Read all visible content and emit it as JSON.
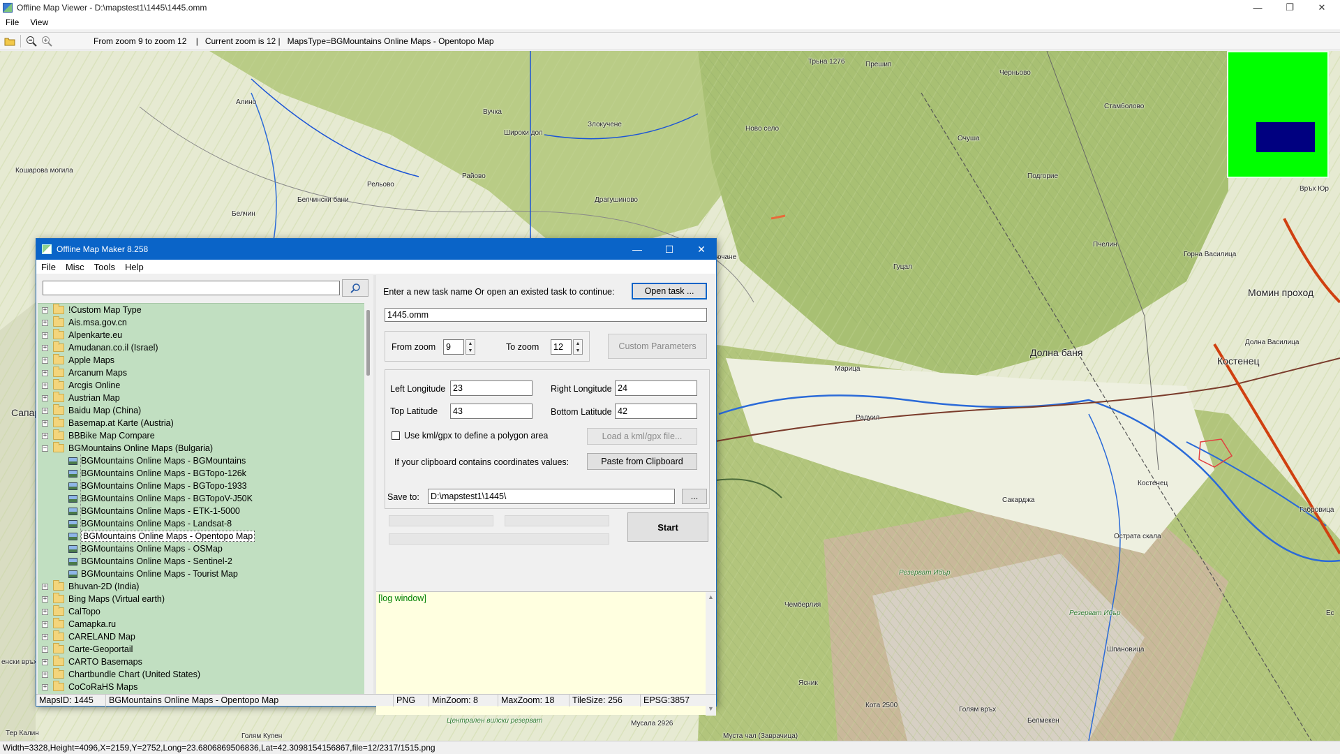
{
  "main_window": {
    "title": "Offline Map Viewer - D:\\mapstest1\\1445\\1445.omm",
    "menu": [
      "File",
      "View"
    ],
    "toolbar_status": "From zoom 9 to zoom 12    |   Current zoom is 12 |   MapsType=BGMountains Online Maps - Opentopo Map",
    "toolbar_icons": [
      "folder-open-icon",
      "zoom-out-icon",
      "zoom-in-icon"
    ],
    "status_bar": "Width=3328,Height=4096,X=2159,Y=2752,Long=23.6806869506836,Lat=42.3098154156867,file=12/2317/1515.png"
  },
  "map_labels": [
    {
      "text": "Трьна 1276",
      "name": "place-trana"
    },
    {
      "text": "Прешип",
      "name": "place-preshtip"
    },
    {
      "text": "Черньово",
      "name": "place-chernyovo"
    },
    {
      "text": "Стамболово",
      "name": "place-stambolovo"
    },
    {
      "text": "Алино",
      "name": "place-alino"
    },
    {
      "text": "Вучка",
      "name": "place-vuchka"
    },
    {
      "text": "Злокучене",
      "name": "place-zlokuchene"
    },
    {
      "text": "Широки дол",
      "name": "place-shiroki-dol"
    },
    {
      "text": "Ново село",
      "name": "place-novo-selo"
    },
    {
      "text": "Очуша",
      "name": "place-ochusha"
    },
    {
      "text": "Кошарова могила",
      "name": "place-kosharova-mogila"
    },
    {
      "text": "Рельово",
      "name": "place-relyovo"
    },
    {
      "text": "Райово",
      "name": "place-rayovo"
    },
    {
      "text": "Подгорие",
      "name": "place-podgorie"
    },
    {
      "text": "Белчински бани",
      "name": "place-belchinski-bani"
    },
    {
      "text": "Драгушиново",
      "name": "place-dragushinovo"
    },
    {
      "text": "Белчин",
      "name": "place-belchin"
    },
    {
      "text": "Връх Юр",
      "name": "place-vrah-yur"
    },
    {
      "text": "Пчелин",
      "name": "place-pchelin"
    },
    {
      "text": "Горна Василица",
      "name": "place-gorna-vasilitsa"
    },
    {
      "text": "Гуцал",
      "name": "place-gutsal"
    },
    {
      "text": "Момин проход",
      "name": "place-momin-prohod"
    },
    {
      "text": "Долна Василица",
      "name": "place-dolna-vasilitsa"
    },
    {
      "text": "Долна баня",
      "name": "place-dolna-banya"
    },
    {
      "text": "Костенец",
      "name": "place-kostenets"
    },
    {
      "text": "Марица",
      "name": "place-maritsa"
    },
    {
      "text": "Радуил",
      "name": "place-raduil"
    },
    {
      "text": "Костенец",
      "name": "place-kostenets-village"
    },
    {
      "text": "Сакарджа",
      "name": "place-sakardzha"
    },
    {
      "text": "Габровица",
      "name": "place-gabrovitsa"
    },
    {
      "text": "Острата скала",
      "name": "place-ostrata-skala"
    },
    {
      "text": "Резерват Ибър",
      "name": "place-rezervat-ibar"
    },
    {
      "text": "Резерват Ибър",
      "name": "place-rezervat-ibar-2"
    },
    {
      "text": "Чемберлия",
      "name": "place-chemberliya"
    },
    {
      "text": "Шпановица",
      "name": "place-shpanovitsa"
    },
    {
      "text": "Ясник",
      "name": "place-yasnik"
    },
    {
      "text": "Кота 2500",
      "name": "place-kota-2500"
    },
    {
      "text": "Голям връх",
      "name": "place-golyam-vrah"
    },
    {
      "text": "Белмекен",
      "name": "place-belmeken"
    },
    {
      "text": "Мусала 2926",
      "name": "place-musala"
    },
    {
      "text": "Централен вилски резерват",
      "name": "place-central-reserve"
    },
    {
      "text": "Голям Купен",
      "name": "place-golyam-kupen"
    },
    {
      "text": "Муста чал (Заврачица)",
      "name": "place-musta-chal"
    },
    {
      "text": "Сапар",
      "name": "place-sapar"
    },
    {
      "text": "ючане",
      "name": "place-yuchane"
    },
    {
      "text": "Ес",
      "name": "place-es"
    },
    {
      "text": "енски връх",
      "name": "place-enski-vrah"
    },
    {
      "text": "Тер Калин",
      "name": "place-ter-kalin"
    }
  ],
  "dialog": {
    "title": "Offline Map Maker 8.258",
    "menu": [
      "File",
      "Misc",
      "Tools",
      "Help"
    ],
    "search_value": "",
    "tree": {
      "top_items": [
        "!Custom Map Type",
        "Ais.msa.gov.cn",
        "Alpenkarte.eu",
        "Amudanan.co.il (Israel)",
        "Apple Maps",
        "Arcanum Maps",
        "Arcgis Online",
        "Austrian Map",
        "Baidu Map (China)",
        "Basemap.at Karte (Austria)",
        "BBBike Map Compare"
      ],
      "expanded_item": "BGMountains Online Maps (Bulgaria)",
      "children": [
        "BGMountains Online Maps - BGMountains",
        "BGMountains Online Maps - BGTopo-126k",
        "BGMountains Online Maps - BGTopo-1933",
        "BGMountains Online Maps - BGTopoV-J50K",
        "BGMountains Online Maps - ETK-1-5000",
        "BGMountains Online Maps - Landsat-8",
        "BGMountains Online Maps - Opentopo Map",
        "BGMountains Online Maps - OSMap",
        "BGMountains Online Maps - Sentinel-2",
        "BGMountains Online Maps - Tourist Map"
      ],
      "selected_child": "BGMountains Online Maps - Opentopo Map",
      "bottom_items": [
        "Bhuvan-2D (India)",
        "Bing Maps (Virtual earth)",
        "CalTopo",
        "Camapka.ru",
        "CARELAND Map",
        "Carte-Geoportail",
        "CARTO Basemaps",
        "Chartbundle Chart (United States)",
        "CoCoRaHS Maps"
      ]
    },
    "task_prompt": "Enter a new task name Or open an existed task to continue:",
    "open_task_label": "Open task ...",
    "task_name": "1445.omm",
    "from_zoom_label": "From zoom",
    "from_zoom_value": "9",
    "to_zoom_label": "To zoom",
    "to_zoom_value": "12",
    "custom_params_label": "Custom Parameters",
    "left_longitude_label": "Left Longitude",
    "left_longitude_value": "23",
    "right_longitude_label": "Right Longitude",
    "right_longitude_value": "24",
    "top_latitude_label": "Top Latitude",
    "top_latitude_value": "43",
    "bottom_latitude_label": "Bottom Latitude",
    "bottom_latitude_value": "42",
    "kml_checkbox_label": "Use kml/gpx to define a polygon area",
    "kml_checkbox_checked": false,
    "load_kml_label": "Load a kml/gpx file...",
    "clipboard_prompt": "If your clipboard contains coordinates values:",
    "paste_label": "Paste from Clipboard",
    "save_to_label": "Save to:",
    "save_to_value": "D:\\mapstest1\\1445\\",
    "browse_label": "...",
    "start_label": "Start",
    "log_text": "[log window]",
    "status": {
      "maps_id": "MapsID: 1445",
      "map_name": "BGMountains Online Maps - Opentopo Map",
      "format": "PNG",
      "min_zoom": "MinZoom: 8",
      "max_zoom": "MaxZoom: 18",
      "tile_size": "TileSize: 256",
      "epsg": "EPSG:3857"
    }
  },
  "colors": {
    "dialog_title_bar": "#0a64c8",
    "tree_background": "#c1dfc1",
    "log_background": "#ffffe0",
    "log_text": "#008000",
    "overview_background": "#00ff00",
    "overview_rect": "#000080"
  }
}
